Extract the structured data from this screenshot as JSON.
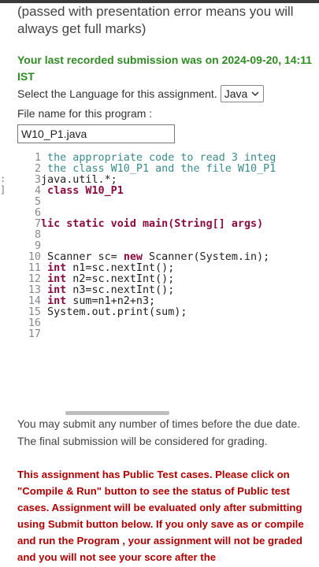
{
  "intro_text": "(passed with presentation error means you will always get full marks)",
  "last_submission": "Your last recorded submission was on 2024-09-20, 14:11 IST",
  "language": {
    "label": "Select the Language for this assignment.",
    "selected": "Java"
  },
  "file_name": {
    "label": "File name for this program :",
    "value": "W10_P1.java"
  },
  "code_lines": [
    {
      "num": "1",
      "text": " the appropriate code to read 3 integ"
    },
    {
      "num": "2",
      "text": " the class W10_P1 and the file W10_P1"
    },
    {
      "num": "3",
      "text": "java.util.*;"
    },
    {
      "num": "4",
      "text": " class W10_P1"
    },
    {
      "num": "5",
      "text": ""
    },
    {
      "num": "6",
      "text": ""
    },
    {
      "num": "7",
      "text": "lic static void main(String[] args)"
    },
    {
      "num": "8",
      "text": ""
    },
    {
      "num": "9",
      "text": ""
    },
    {
      "num": "10",
      "text": " Scanner sc= new Scanner(System.in);"
    },
    {
      "num": "11",
      "text": " int n1=sc.nextInt();"
    },
    {
      "num": "12",
      "text": " int n2=sc.nextInt();"
    },
    {
      "num": "13",
      "text": " int n3=sc.nextInt();"
    },
    {
      "num": "14",
      "text": " int sum=n1+n2+n3;"
    },
    {
      "num": "15",
      "text": " System.out.print(sum);"
    },
    {
      "num": "16",
      "text": ""
    },
    {
      "num": "17",
      "text": ""
    }
  ],
  "submit_info": "You may submit any number of times before the due date. The final submission will be considered for grading.",
  "public_test_notice": "This assignment has Public Test cases. Please click on \"Compile & Run\" button to see the status of Public test cases. Assignment will be evaluated only after submitting using Submit button below. If you only save as or compile and run the Program , your assignment will not be graded and you will not see your score after the"
}
